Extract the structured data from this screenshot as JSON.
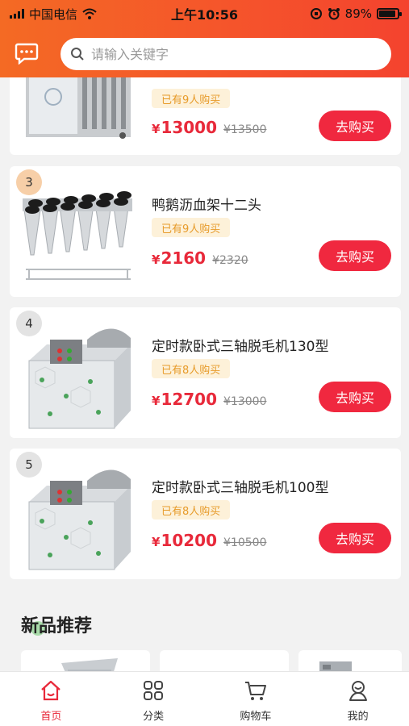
{
  "status_bar": {
    "carrier": "中国电信",
    "time": "上午10:56",
    "battery": "89%",
    "battery_level": 0.89
  },
  "search": {
    "placeholder": "请输入关键字"
  },
  "products": [
    {
      "rank": "",
      "name": "",
      "sold": "已有9人购买",
      "price": "13000",
      "old_price": "¥13500",
      "buy": "去购买"
    },
    {
      "rank": "3",
      "name": "鸭鹅沥血架十二头",
      "sold": "已有9人购买",
      "price": "2160",
      "old_price": "¥2320",
      "buy": "去购买"
    },
    {
      "rank": "4",
      "name": "定时款卧式三轴脱毛机130型",
      "sold": "已有8人购买",
      "price": "12700",
      "old_price": "¥13000",
      "buy": "去购买"
    },
    {
      "rank": "5",
      "name": "定时款卧式三轴脱毛机100型",
      "sold": "已有8人购买",
      "price": "10200",
      "old_price": "¥10500",
      "buy": "去购买"
    }
  ],
  "currency": "¥",
  "section": {
    "title": "新品推荐"
  },
  "tabbar": {
    "tabs": [
      {
        "label": "首页",
        "icon": "home-icon",
        "active": true
      },
      {
        "label": "分类",
        "icon": "category-grid-icon",
        "active": false
      },
      {
        "label": "购物车",
        "icon": "cart-icon",
        "active": false
      },
      {
        "label": "我的",
        "icon": "user-icon",
        "active": false
      }
    ]
  },
  "colors": {
    "brand_orange": "#f46a24",
    "price_red": "#e8293a",
    "buy_button": "#f0283f",
    "sold_badge_bg": "#fdf1d9",
    "sold_badge_text": "#e79b2a"
  }
}
